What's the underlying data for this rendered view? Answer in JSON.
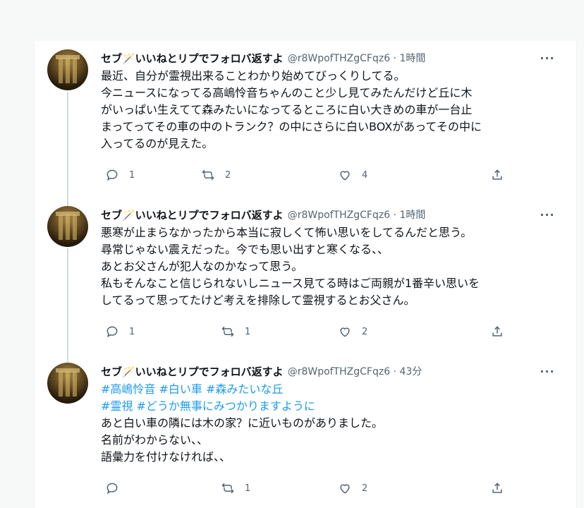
{
  "tweets": [
    {
      "name": "セブ🪄いいねとリプでフォロバ返すよ",
      "handle": "@r8WpofTHZgCFqz6 · 1時間",
      "more": "···",
      "lines": [
        "最近、自分が霊視出来ることわかり始めてびっくりしてる。",
        "今ニュースになってる高嶋怜音ちゃんのこと少し見てみたんだけど丘に木",
        "がいっぱい生えてて森みたいになってるところに白い大きめの車が一台止",
        "まってってその車の中のトランク？の中にさらに白いBOXがあってその中に",
        "入ってるのが見えた。"
      ],
      "reply_count": "1",
      "retweet_count": "2",
      "like_count": "4"
    },
    {
      "name": "セブ🪄いいねとリプでフォロバ返すよ",
      "handle": "@r8WpofTHZgCFqz6 · 1時間",
      "more": "···",
      "lines": [
        "悪寒が止まらなかったから本当に寂しくて怖い思いをしてるんだと思う。",
        "尋常じゃない震えだった。今でも思い出すと寒くなる、、",
        "あとお父さんが犯人なのかなって思う。",
        "私もそんなこと信じられないしニュース見てる時はご両親が1番辛い思いを",
        "してるって思ってたけど考えを排除して霊視するとお父さん。"
      ],
      "reply_count": "1",
      "retweet_count": "1",
      "like_count": "2"
    },
    {
      "name": "セブ🪄いいねとリプでフォロバ返すよ",
      "handle": "@r8WpofTHZgCFqz6 · 43分",
      "more": "···",
      "hashtags_line1": "#高嶋怜音 #白い車 #森みたいな丘",
      "hashtags_line2": "#霊視 #どうか無事にみつかりますように",
      "lines": [
        "あと白い車の隣には木の家？に近いものがありました。",
        "名前がわからない、、",
        "語彙力を付けなければ、、"
      ],
      "reply_count": "",
      "retweet_count": "1",
      "like_count": "2"
    }
  ],
  "icons": [
    "reply-icon",
    "retweet-icon",
    "like-icon",
    "share-icon",
    "more-icon"
  ],
  "colors": {
    "text": "#0f1419",
    "secondary": "#536471",
    "link": "#1d9bf0",
    "thread": "#cfd9de"
  }
}
